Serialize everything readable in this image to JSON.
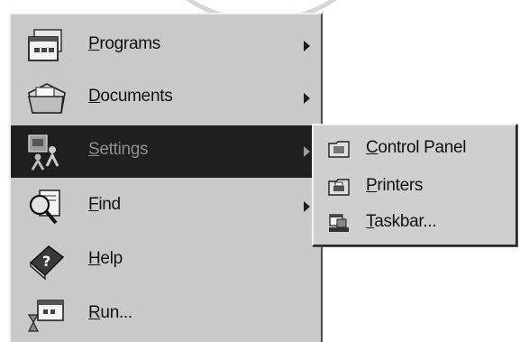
{
  "start_menu": {
    "items": [
      {
        "label_first": "P",
        "label_rest": "rograms",
        "icon": "programs-icon",
        "has_submenu": true
      },
      {
        "label_first": "D",
        "label_rest": "ocuments",
        "icon": "documents-icon",
        "has_submenu": true
      },
      {
        "label_first": "S",
        "label_rest": "ettings",
        "icon": "settings-icon",
        "has_submenu": true,
        "selected": true
      },
      {
        "label_first": "F",
        "label_rest": "ind",
        "icon": "find-icon",
        "has_submenu": true
      },
      {
        "label_first": "H",
        "label_rest": "elp",
        "icon": "help-icon",
        "has_submenu": false
      },
      {
        "label_first": "R",
        "label_rest": "un...",
        "icon": "run-icon",
        "has_submenu": false
      }
    ]
  },
  "settings_submenu": {
    "items": [
      {
        "label_first": "C",
        "label_rest": "ontrol Panel",
        "icon": "control-panel-icon"
      },
      {
        "label_first": "P",
        "label_rest": "rinters",
        "icon": "printers-icon"
      },
      {
        "label_first": "T",
        "label_rest": "askbar...",
        "icon": "taskbar-icon"
      }
    ]
  }
}
